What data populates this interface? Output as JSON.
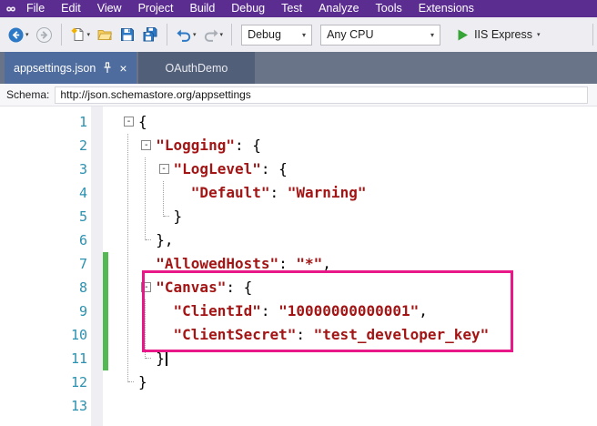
{
  "menu": {
    "items": [
      "File",
      "Edit",
      "View",
      "Project",
      "Build",
      "Debug",
      "Test",
      "Analyze",
      "Tools",
      "Extensions"
    ]
  },
  "toolbar": {
    "debug_target": "Debug",
    "platform": "Any CPU",
    "run_label": "IIS Express"
  },
  "icons": {
    "caret": "▾",
    "close": "×",
    "fold_open": "-"
  },
  "tabs": {
    "active": {
      "label": "appsettings.json"
    },
    "inactive": {
      "label": "OAuthDemo"
    }
  },
  "schema": {
    "label": "Schema:",
    "value": "http://json.schemastore.org/appsettings"
  },
  "colors": {
    "menu_bg": "#5B2D90",
    "tab_strip": "#6A7489",
    "active_tab": "#4E6C9D",
    "inactive_tab": "#525F79",
    "line_number": "#2B91AF",
    "json_string": "#A31515",
    "changed_bar": "#53B953",
    "highlight_box": "#E81889",
    "run_green": "#37A437"
  },
  "editor": {
    "lines": [
      {
        "num": "1",
        "indent": 0,
        "fold": true,
        "changed": false,
        "tokens": [
          {
            "t": "{",
            "c": "p"
          }
        ]
      },
      {
        "num": "2",
        "indent": 2,
        "fold": true,
        "changed": false,
        "tokens": [
          {
            "t": "  ",
            "c": "p"
          },
          {
            "t": "\"Logging\"",
            "c": "s"
          },
          {
            "t": ": {",
            "c": "p"
          }
        ]
      },
      {
        "num": "3",
        "indent": 4,
        "fold": true,
        "changed": false,
        "tokens": [
          {
            "t": "    ",
            "c": "p"
          },
          {
            "t": "\"LogLevel\"",
            "c": "s"
          },
          {
            "t": ": {",
            "c": "p"
          }
        ]
      },
      {
        "num": "4",
        "indent": 6,
        "fold": false,
        "changed": false,
        "tokens": [
          {
            "t": "      ",
            "c": "p"
          },
          {
            "t": "\"Default\"",
            "c": "s"
          },
          {
            "t": ": ",
            "c": "p"
          },
          {
            "t": "\"Warning\"",
            "c": "s"
          }
        ]
      },
      {
        "num": "5",
        "indent": 4,
        "fold": false,
        "changed": false,
        "tokens": [
          {
            "t": "    }",
            "c": "p"
          }
        ]
      },
      {
        "num": "6",
        "indent": 2,
        "fold": false,
        "changed": false,
        "tokens": [
          {
            "t": "  },",
            "c": "p"
          }
        ]
      },
      {
        "num": "7",
        "indent": 2,
        "fold": false,
        "changed": true,
        "tokens": [
          {
            "t": "  ",
            "c": "p"
          },
          {
            "t": "\"AllowedHosts\"",
            "c": "s"
          },
          {
            "t": ": ",
            "c": "p"
          },
          {
            "t": "\"*\"",
            "c": "s"
          },
          {
            "t": ",",
            "c": "p"
          }
        ]
      },
      {
        "num": "8",
        "indent": 2,
        "fold": true,
        "changed": true,
        "tokens": [
          {
            "t": "  ",
            "c": "p"
          },
          {
            "t": "\"Canvas\"",
            "c": "s"
          },
          {
            "t": ": {",
            "c": "p"
          }
        ]
      },
      {
        "num": "9",
        "indent": 4,
        "fold": false,
        "changed": true,
        "tokens": [
          {
            "t": "    ",
            "c": "p"
          },
          {
            "t": "\"ClientId\"",
            "c": "s"
          },
          {
            "t": ": ",
            "c": "p"
          },
          {
            "t": "\"10000000000001\"",
            "c": "s"
          },
          {
            "t": ",",
            "c": "p"
          }
        ]
      },
      {
        "num": "10",
        "indent": 4,
        "fold": false,
        "changed": true,
        "tokens": [
          {
            "t": "    ",
            "c": "p"
          },
          {
            "t": "\"ClientSecret\"",
            "c": "s"
          },
          {
            "t": ": ",
            "c": "p"
          },
          {
            "t": "\"test_developer_key\"",
            "c": "s"
          }
        ]
      },
      {
        "num": "11",
        "indent": 2,
        "fold": false,
        "changed": true,
        "caret": true,
        "tokens": [
          {
            "t": "  }",
            "c": "p"
          }
        ]
      },
      {
        "num": "12",
        "indent": 0,
        "fold": false,
        "changed": false,
        "tokens": [
          {
            "t": "}",
            "c": "p"
          }
        ]
      },
      {
        "num": "13",
        "indent": 0,
        "fold": false,
        "changed": false,
        "tokens": []
      }
    ],
    "fold_regions": [
      {
        "start": 1,
        "end": 12,
        "indent": 0
      },
      {
        "start": 2,
        "end": 6,
        "indent": 2
      },
      {
        "start": 3,
        "end": 5,
        "indent": 4
      },
      {
        "start": 8,
        "end": 11,
        "indent": 2
      }
    ]
  }
}
